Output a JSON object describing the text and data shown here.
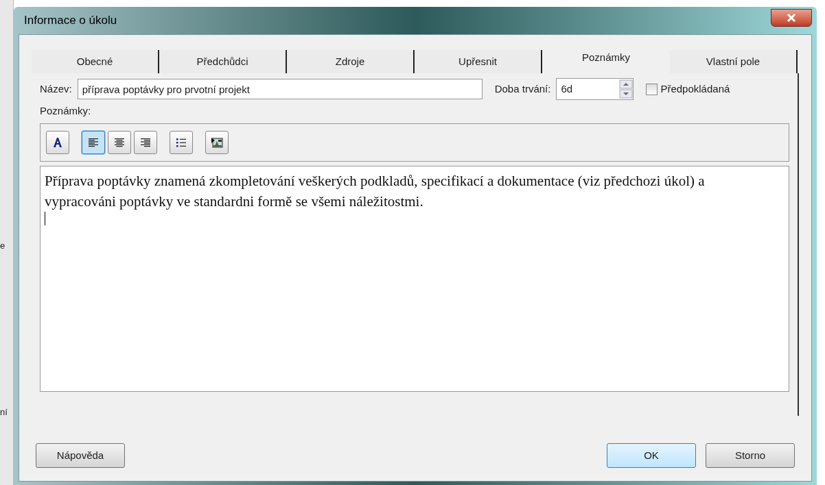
{
  "background_fragments": [
    "e",
    "ní"
  ],
  "window": {
    "title": "Informace o úkolu"
  },
  "tabs": [
    {
      "label": "Obecné",
      "selected": false
    },
    {
      "label": "Předchůdci",
      "selected": false
    },
    {
      "label": "Zdroje",
      "selected": false
    },
    {
      "label": "Upřesnit",
      "selected": false
    },
    {
      "label": "Poznámky",
      "selected": true
    },
    {
      "label": "Vlastní pole",
      "selected": false
    }
  ],
  "name_field": {
    "label": "Název:",
    "value": "příprava poptávky pro prvotní projekt"
  },
  "duration_field": {
    "label": "Doba trvání:",
    "value": "6d"
  },
  "estimated_checkbox": {
    "label": "Předpokládaná",
    "checked": false
  },
  "notes_label": "Poznámky:",
  "toolbar": [
    {
      "kind": "font",
      "selected": false
    },
    {
      "kind": "align-left",
      "selected": true
    },
    {
      "kind": "align-center",
      "selected": false
    },
    {
      "kind": "align-right",
      "selected": false
    },
    {
      "kind": "bullets",
      "selected": false
    },
    {
      "kind": "object",
      "selected": false
    }
  ],
  "notes_text": "Příprava poptávky znamená zkompletování veškerých podkladů, specifikací a dokumentace (viz předchozi úkol) a vypracováni poptávky ve standardni formě se všemi náležitostmi.",
  "buttons": [
    {
      "label": "Nápověda",
      "default": false
    },
    {
      "label": "OK",
      "default": true
    },
    {
      "label": "Storno",
      "default": false
    }
  ]
}
